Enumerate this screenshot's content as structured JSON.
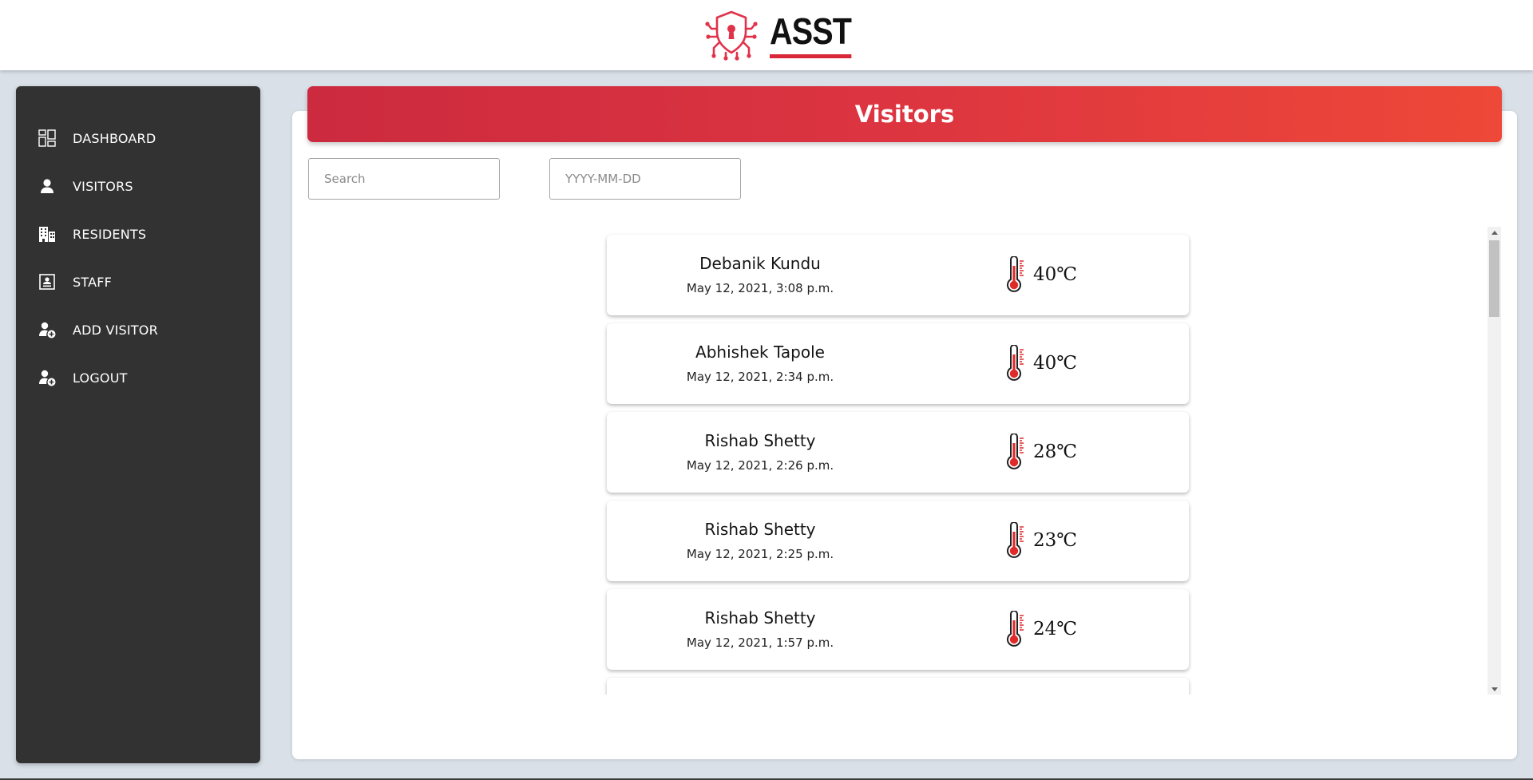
{
  "brand": {
    "name": "ASST",
    "logo_icon": "shield-keyhole-circuit-icon",
    "accent_color": "#d92638"
  },
  "sidebar": {
    "items": [
      {
        "label": "DASHBOARD",
        "icon": "dashboard-icon"
      },
      {
        "label": "VISITORS",
        "icon": "person-icon"
      },
      {
        "label": "RESIDENTS",
        "icon": "building-icon"
      },
      {
        "label": "STAFF",
        "icon": "id-card-icon"
      },
      {
        "label": "ADD VISITOR",
        "icon": "add-user-icon"
      },
      {
        "label": "LOGOUT",
        "icon": "user-logout-icon"
      }
    ]
  },
  "main": {
    "title": "Visitors",
    "search": {
      "placeholder": "Search",
      "value": ""
    },
    "date_filter": {
      "placeholder": "YYYY-MM-DD",
      "value": ""
    }
  },
  "visitors": [
    {
      "name": "Debanik Kundu",
      "time": "May 12, 2021, 3:08 p.m.",
      "temperature": "40℃"
    },
    {
      "name": "Abhishek Tapole",
      "time": "May 12, 2021, 2:34 p.m.",
      "temperature": "40℃"
    },
    {
      "name": "Rishab Shetty",
      "time": "May 12, 2021, 2:26 p.m.",
      "temperature": "28℃"
    },
    {
      "name": "Rishab Shetty",
      "time": "May 12, 2021, 2:25 p.m.",
      "temperature": "23℃"
    },
    {
      "name": "Rishab Shetty",
      "time": "May 12, 2021, 1:57 p.m.",
      "temperature": "24℃"
    }
  ]
}
